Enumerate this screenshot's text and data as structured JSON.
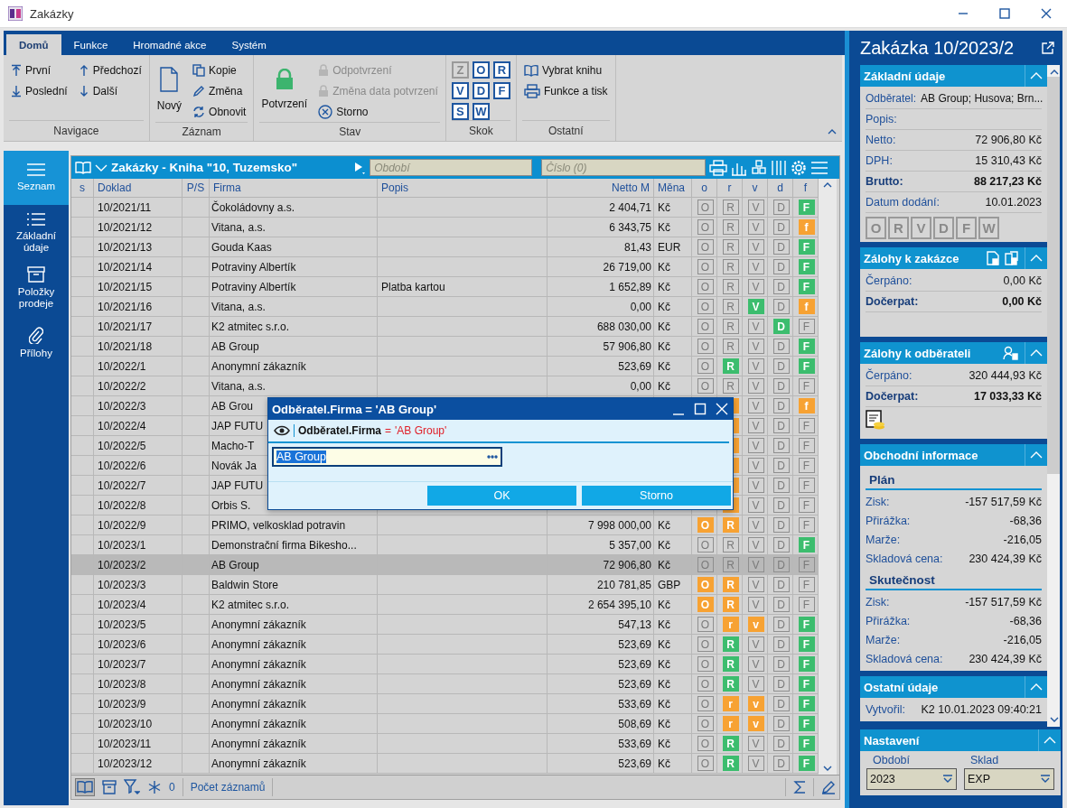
{
  "window": {
    "title": "Zakázky"
  },
  "ribbon": {
    "tabs": [
      {
        "label": "Domů",
        "selected": true
      },
      {
        "label": "Funkce",
        "selected": false
      },
      {
        "label": "Hromadné akce",
        "selected": false
      },
      {
        "label": "Systém",
        "selected": false
      }
    ],
    "groups": [
      {
        "kind": "nav",
        "title": "Navigace",
        "items": [
          {
            "label": "První"
          },
          {
            "label": "Předchozí"
          },
          {
            "label": "Poslední"
          },
          {
            "label": "Další"
          }
        ]
      },
      {
        "kind": "record",
        "title": "Záznam",
        "items": [
          {
            "label": "Nový"
          },
          {
            "label": "Kopie"
          },
          {
            "label": "Změna"
          },
          {
            "label": "Obnovit"
          }
        ]
      },
      {
        "kind": "state",
        "title": "Stav",
        "items": [
          {
            "label": "Potvrzení",
            "disabled": false
          },
          {
            "label": "Odpotvrzení",
            "disabled": true
          },
          {
            "label": "Změna data potvrzení",
            "disabled": true
          },
          {
            "label": "Storno",
            "disabled": false
          }
        ]
      },
      {
        "kind": "jump",
        "title": "Skok",
        "items": [
          {
            "label": "Z",
            "disabled": true
          },
          {
            "label": "O",
            "disabled": false
          },
          {
            "label": "R",
            "disabled": false
          },
          {
            "label": "V",
            "disabled": false
          },
          {
            "label": "D",
            "disabled": false
          },
          {
            "label": "F",
            "disabled": false
          },
          {
            "label": "S",
            "disabled": false
          },
          {
            "label": "W",
            "disabled": false
          }
        ]
      },
      {
        "kind": "other",
        "title": "Ostatní",
        "items": [
          {
            "label": "Vybrat knihu"
          },
          {
            "label": "Funkce a tisk"
          }
        ]
      }
    ]
  },
  "sidebar": {
    "items": [
      {
        "label": "Seznam",
        "selected": true
      },
      {
        "label": "Základní údaje",
        "selected": false
      },
      {
        "label": "Položky prodeje",
        "selected": false
      },
      {
        "label": "Přílohy",
        "selected": false
      }
    ]
  },
  "table": {
    "title": "Zakázky - Kniha \"10, Tuzemsko\"",
    "period_field": {
      "placeholder": "Období"
    },
    "number_field": {
      "placeholder": "Číslo (0)"
    },
    "columns": [
      "s",
      "Doklad",
      "P/S",
      "Firma",
      "Popis",
      "Netto M",
      "Měna",
      "o",
      "r",
      "v",
      "d",
      "f"
    ],
    "rows": [
      {
        "selected": false,
        "doklad": "10/2021/11",
        "firma": "Čokoládovny a.s.",
        "netto": "2 404,71",
        "mena": "Kč",
        "o": {
          "letter": "O",
          "active": false
        },
        "r": {
          "letter": "R",
          "active": false
        },
        "v": {
          "letter": "V",
          "active": false
        },
        "d": {
          "letter": "D",
          "active": false
        },
        "f": {
          "letter": "F",
          "active": true,
          "color": "#3cbd6e"
        }
      },
      {
        "selected": false,
        "doklad": "10/2021/12",
        "firma": "Vitana, a.s.",
        "netto": "6 343,75",
        "mena": "Kč",
        "o": {
          "letter": "O",
          "active": false
        },
        "r": {
          "letter": "R",
          "active": false
        },
        "v": {
          "letter": "V",
          "active": false
        },
        "d": {
          "letter": "D",
          "active": false
        },
        "f": {
          "letter": "f",
          "active": true,
          "color": "#f7a233"
        }
      },
      {
        "selected": false,
        "doklad": "10/2021/13",
        "firma": "Gouda Kaas",
        "netto": "81,43",
        "mena": "EUR",
        "o": {
          "letter": "O",
          "active": false
        },
        "r": {
          "letter": "R",
          "active": false
        },
        "v": {
          "letter": "V",
          "active": false
        },
        "d": {
          "letter": "D",
          "active": false
        },
        "f": {
          "letter": "F",
          "active": true,
          "color": "#3cbd6e"
        }
      },
      {
        "selected": false,
        "doklad": "10/2021/14",
        "firma": "Potraviny Albertík",
        "netto": "26 719,00",
        "mena": "Kč",
        "o": {
          "letter": "O",
          "active": false
        },
        "r": {
          "letter": "R",
          "active": false
        },
        "v": {
          "letter": "V",
          "active": false
        },
        "d": {
          "letter": "D",
          "active": false
        },
        "f": {
          "letter": "F",
          "active": true,
          "color": "#3cbd6e"
        }
      },
      {
        "selected": false,
        "doklad": "10/2021/15",
        "firma": "Potraviny Albertík",
        "popis": "Platba kartou",
        "netto": "1 652,89",
        "mena": "Kč",
        "o": {
          "letter": "O",
          "active": false
        },
        "r": {
          "letter": "R",
          "active": false
        },
        "v": {
          "letter": "V",
          "active": false
        },
        "d": {
          "letter": "D",
          "active": false
        },
        "f": {
          "letter": "F",
          "active": true,
          "color": "#3cbd6e"
        }
      },
      {
        "selected": false,
        "doklad": "10/2021/16",
        "firma": "Vitana, a.s.",
        "netto": "0,00",
        "mena": "Kč",
        "o": {
          "letter": "O",
          "active": false
        },
        "r": {
          "letter": "R",
          "active": false
        },
        "v": {
          "letter": "V",
          "active": true,
          "color": "#3cbd6e"
        },
        "d": {
          "letter": "D",
          "active": false
        },
        "f": {
          "letter": "f",
          "active": true,
          "color": "#f7a233"
        }
      },
      {
        "selected": false,
        "doklad": "10/2021/17",
        "firma": "K2 atmitec s.r.o.",
        "netto": "688 030,00",
        "mena": "Kč",
        "o": {
          "letter": "O",
          "active": false
        },
        "r": {
          "letter": "R",
          "active": false
        },
        "v": {
          "letter": "V",
          "active": false
        },
        "d": {
          "letter": "D",
          "active": true,
          "color": "#3cbd6e"
        },
        "f": {
          "letter": "F",
          "active": false
        }
      },
      {
        "selected": false,
        "doklad": "10/2021/18",
        "firma": "AB Group",
        "netto": "57 906,80",
        "mena": "Kč",
        "o": {
          "letter": "O",
          "active": false
        },
        "r": {
          "letter": "R",
          "active": false
        },
        "v": {
          "letter": "V",
          "active": false
        },
        "d": {
          "letter": "D",
          "active": false
        },
        "f": {
          "letter": "F",
          "active": true,
          "color": "#3cbd6e"
        }
      },
      {
        "selected": false,
        "doklad": "10/2022/1",
        "firma": "Anonymní zákazník",
        "netto": "523,69",
        "mena": "Kč",
        "o": {
          "letter": "O",
          "active": false
        },
        "r": {
          "letter": "R",
          "active": true,
          "color": "#3cbd6e"
        },
        "v": {
          "letter": "V",
          "active": false
        },
        "d": {
          "letter": "D",
          "active": false
        },
        "f": {
          "letter": "F",
          "active": true,
          "color": "#3cbd6e"
        }
      },
      {
        "selected": false,
        "doklad": "10/2022/2",
        "firma": "Vitana, a.s.",
        "netto": "0,00",
        "mena": "Kč",
        "o": {
          "letter": "O",
          "active": false
        },
        "r": {
          "letter": "R",
          "active": false
        },
        "v": {
          "letter": "V",
          "active": false
        },
        "d": {
          "letter": "D",
          "active": false
        },
        "f": {
          "letter": "F",
          "active": false
        }
      },
      {
        "selected": false,
        "doklad": "10/2022/3",
        "firma": "AB Grou",
        "r": {
          "active": true,
          "color": "#f7a233"
        },
        "v": {
          "letter": "V",
          "active": false
        },
        "d": {
          "letter": "D",
          "active": false
        },
        "f": {
          "letter": "f",
          "active": true,
          "color": "#f7a233"
        }
      },
      {
        "selected": false,
        "doklad": "10/2022/4",
        "firma": "JAP FUTU",
        "r": {
          "active": true,
          "color": "#f7a233"
        },
        "v": {
          "letter": "V",
          "active": false
        },
        "d": {
          "letter": "D",
          "active": false
        },
        "f": {
          "letter": "F",
          "active": false
        }
      },
      {
        "selected": false,
        "doklad": "10/2022/5",
        "firma": "Macho-T",
        "r": {
          "active": true,
          "color": "#f7a233"
        },
        "v": {
          "letter": "V",
          "active": false
        },
        "d": {
          "letter": "D",
          "active": false
        },
        "f": {
          "letter": "F",
          "active": false
        }
      },
      {
        "selected": false,
        "doklad": "10/2022/6",
        "firma": "Novák Ja",
        "r": {
          "active": true,
          "color": "#f7a233"
        },
        "v": {
          "letter": "V",
          "active": false
        },
        "d": {
          "letter": "D",
          "active": false
        },
        "f": {
          "letter": "F",
          "active": false
        }
      },
      {
        "selected": false,
        "doklad": "10/2022/7",
        "firma": "JAP FUTU",
        "r": {
          "active": true,
          "color": "#f7a233"
        },
        "v": {
          "letter": "V",
          "active": false
        },
        "d": {
          "letter": "D",
          "active": false
        },
        "f": {
          "letter": "F",
          "active": false
        }
      },
      {
        "selected": false,
        "doklad": "10/2022/8",
        "firma": "Orbis S.",
        "r": {
          "active": true,
          "color": "#f7a233"
        },
        "v": {
          "letter": "V",
          "active": false
        },
        "d": {
          "letter": "D",
          "active": false
        },
        "f": {
          "letter": "F",
          "active": false
        }
      },
      {
        "selected": false,
        "doklad": "10/2022/9",
        "firma": "PRIMO, velkosklad potravin",
        "netto": "7 998 000,00",
        "mena": "Kč",
        "o": {
          "letter": "O",
          "active": true,
          "color": "#f7a233"
        },
        "r": {
          "letter": "R",
          "active": true,
          "color": "#f7a233"
        },
        "v": {
          "letter": "V",
          "active": false
        },
        "d": {
          "letter": "D",
          "active": false
        },
        "f": {
          "letter": "F",
          "active": false
        }
      },
      {
        "selected": false,
        "doklad": "10/2023/1",
        "firma": "Demonstrační firma Bikesho...",
        "netto": "5 357,00",
        "mena": "Kč",
        "o": {
          "letter": "O",
          "active": false
        },
        "r": {
          "letter": "R",
          "active": false
        },
        "v": {
          "letter": "V",
          "active": false
        },
        "d": {
          "letter": "D",
          "active": false
        },
        "f": {
          "letter": "F",
          "active": true,
          "color": "#3cbd6e"
        }
      },
      {
        "selected": true,
        "doklad": "10/2023/2",
        "firma": "AB Group",
        "netto": "72 906,80",
        "mena": "Kč",
        "o": {
          "letter": "O",
          "active": false
        },
        "r": {
          "letter": "R",
          "active": false
        },
        "v": {
          "letter": "V",
          "active": false
        },
        "d": {
          "letter": "D",
          "active": false
        },
        "f": {
          "letter": "F",
          "active": false
        }
      },
      {
        "selected": false,
        "doklad": "10/2023/3",
        "firma": "Baldwin Store",
        "netto": "210 781,85",
        "mena": "GBP",
        "o": {
          "letter": "O",
          "active": true,
          "color": "#f7a233"
        },
        "r": {
          "letter": "R",
          "active": true,
          "color": "#f7a233"
        },
        "v": {
          "letter": "V",
          "active": false
        },
        "d": {
          "letter": "D",
          "active": false
        },
        "f": {
          "letter": "F",
          "active": false
        }
      },
      {
        "selected": false,
        "doklad": "10/2023/4",
        "firma": "K2 atmitec s.r.o.",
        "netto": "2 654 395,10",
        "mena": "Kč",
        "o": {
          "letter": "O",
          "active": true,
          "color": "#f7a233"
        },
        "r": {
          "letter": "R",
          "active": true,
          "color": "#f7a233"
        },
        "v": {
          "letter": "V",
          "active": false
        },
        "d": {
          "letter": "D",
          "active": false
        },
        "f": {
          "letter": "F",
          "active": false
        }
      },
      {
        "selected": false,
        "doklad": "10/2023/5",
        "firma": "Anonymní zákazník",
        "netto": "547,13",
        "mena": "Kč",
        "o": {
          "letter": "O",
          "active": false
        },
        "r": {
          "letter": "r",
          "active": true,
          "color": "#f7a233"
        },
        "v": {
          "letter": "v",
          "active": true,
          "color": "#f7a233"
        },
        "d": {
          "letter": "D",
          "active": false
        },
        "f": {
          "letter": "F",
          "active": true,
          "color": "#3cbd6e"
        }
      },
      {
        "selected": false,
        "doklad": "10/2023/6",
        "firma": "Anonymní zákazník",
        "netto": "523,69",
        "mena": "Kč",
        "o": {
          "letter": "O",
          "active": false
        },
        "r": {
          "letter": "R",
          "active": true,
          "color": "#3cbd6e"
        },
        "v": {
          "letter": "V",
          "active": false
        },
        "d": {
          "letter": "D",
          "active": false
        },
        "f": {
          "letter": "F",
          "active": true,
          "color": "#3cbd6e"
        }
      },
      {
        "selected": false,
        "doklad": "10/2023/7",
        "firma": "Anonymní zákazník",
        "netto": "523,69",
        "mena": "Kč",
        "o": {
          "letter": "O",
          "active": false
        },
        "r": {
          "letter": "R",
          "active": true,
          "color": "#3cbd6e"
        },
        "v": {
          "letter": "V",
          "active": false
        },
        "d": {
          "letter": "D",
          "active": false
        },
        "f": {
          "letter": "F",
          "active": true,
          "color": "#3cbd6e"
        }
      },
      {
        "selected": false,
        "doklad": "10/2023/8",
        "firma": "Anonymní zákazník",
        "netto": "523,69",
        "mena": "Kč",
        "o": {
          "letter": "O",
          "active": false
        },
        "r": {
          "letter": "R",
          "active": true,
          "color": "#3cbd6e"
        },
        "v": {
          "letter": "V",
          "active": false
        },
        "d": {
          "letter": "D",
          "active": false
        },
        "f": {
          "letter": "F",
          "active": true,
          "color": "#3cbd6e"
        }
      },
      {
        "selected": false,
        "doklad": "10/2023/9",
        "firma": "Anonymní zákazník",
        "netto": "533,69",
        "mena": "Kč",
        "o": {
          "letter": "O",
          "active": false
        },
        "r": {
          "letter": "r",
          "active": true,
          "color": "#f7a233"
        },
        "v": {
          "letter": "v",
          "active": true,
          "color": "#f7a233"
        },
        "d": {
          "letter": "D",
          "active": false
        },
        "f": {
          "letter": "F",
          "active": true,
          "color": "#3cbd6e"
        }
      },
      {
        "selected": false,
        "doklad": "10/2023/10",
        "firma": "Anonymní zákazník",
        "netto": "508,69",
        "mena": "Kč",
        "o": {
          "letter": "O",
          "active": false
        },
        "r": {
          "letter": "r",
          "active": true,
          "color": "#f7a233"
        },
        "v": {
          "letter": "v",
          "active": true,
          "color": "#f7a233"
        },
        "d": {
          "letter": "D",
          "active": false
        },
        "f": {
          "letter": "F",
          "active": true,
          "color": "#3cbd6e"
        }
      },
      {
        "selected": false,
        "doklad": "10/2023/11",
        "firma": "Anonymní zákazník",
        "netto": "533,69",
        "mena": "Kč",
        "o": {
          "letter": "O",
          "active": false
        },
        "r": {
          "letter": "R",
          "active": true,
          "color": "#3cbd6e"
        },
        "v": {
          "letter": "V",
          "active": false
        },
        "d": {
          "letter": "D",
          "active": false
        },
        "f": {
          "letter": "F",
          "active": true,
          "color": "#3cbd6e"
        }
      },
      {
        "selected": false,
        "doklad": "10/2023/12",
        "firma": "Anonymní zákazník",
        "netto": "523,69",
        "mena": "Kč",
        "o": {
          "letter": "O",
          "active": false
        },
        "r": {
          "letter": "R",
          "active": true,
          "color": "#3cbd6e"
        },
        "v": {
          "letter": "V",
          "active": false
        },
        "d": {
          "letter": "D",
          "active": false
        },
        "f": {
          "letter": "F",
          "active": true,
          "color": "#3cbd6e"
        }
      }
    ],
    "footer": {
      "count": "0",
      "label": "Počet záznamů"
    }
  },
  "dialog": {
    "title": "Odběratel.Firma = 'AB Group'",
    "condition": {
      "field": "Odběratel.Firma",
      "operator": "=",
      "value": "'AB Group'"
    },
    "input": {
      "value": "AB Group"
    },
    "buttons": [
      "OK",
      "Storno"
    ]
  },
  "detail": {
    "title": "Zakázka 10/2023/2",
    "sections": [
      {
        "kind": "basic",
        "title": "Základní údaje",
        "rows": [
          {
            "kind": "inline",
            "label": "Odběratel:",
            "value": "AB Group; Husova; Brn..."
          },
          {
            "kind": "field",
            "label": "Popis:"
          },
          {
            "kind": "field",
            "label": "Netto:",
            "value": "72 906,80 Kč"
          },
          {
            "kind": "field",
            "label": "DPH:",
            "value": "15 310,43 Kč"
          },
          {
            "kind": "total",
            "label": "Brutto:",
            "value": "88 217,23 Kč"
          },
          {
            "kind": "field",
            "label": "Datum dodání:",
            "value": "10.01.2023"
          }
        ],
        "flags": [
          {
            "letter": "O",
            "disabled": true
          },
          {
            "letter": "R",
            "disabled": true
          },
          {
            "letter": "V",
            "disabled": true
          },
          {
            "letter": "D",
            "disabled": true
          },
          {
            "letter": "F",
            "disabled": true
          },
          {
            "letter": "W",
            "disabled": true
          }
        ]
      },
      {
        "kind": "advances_order",
        "title": "Zálohy k zakázce",
        "rows": [
          {
            "kind": "field",
            "label": "Čerpáno:",
            "value": "0,00 Kč"
          },
          {
            "kind": "total",
            "label": "Dočerpat:",
            "value": "0,00 Kč"
          }
        ]
      },
      {
        "kind": "advances_customer",
        "title": "Zálohy k odběrateli",
        "rows": [
          {
            "kind": "field",
            "label": "Čerpáno:",
            "value": "320 444,93 Kč"
          },
          {
            "kind": "total",
            "label": "Dočerpat:",
            "value": "17 033,33 Kč"
          }
        ]
      },
      {
        "kind": "business",
        "title": "Obchodní informace",
        "rows": [
          {
            "kind": "heading",
            "label": "Plán"
          },
          {
            "kind": "plain",
            "label": "Zisk:",
            "value": "-157 517,59 Kč"
          },
          {
            "kind": "plain",
            "label": "Přirážka:",
            "value": "-68,36"
          },
          {
            "kind": "plain",
            "label": "Marže:",
            "value": "-216,05"
          },
          {
            "kind": "plain",
            "label": "Skladová cena:",
            "value": "230 424,39 Kč"
          },
          {
            "kind": "heading",
            "label": "Skutečnost"
          },
          {
            "kind": "plain",
            "label": "Zisk:",
            "value": "-157 517,59 Kč"
          },
          {
            "kind": "plain",
            "label": "Přirážka:",
            "value": "-68,36"
          },
          {
            "kind": "plain",
            "label": "Marže:",
            "value": "-216,05"
          },
          {
            "kind": "plain",
            "label": "Skladová cena:",
            "value": "230 424,39 Kč"
          }
        ]
      },
      {
        "kind": "other",
        "title": "Ostatní údaje",
        "rows": [
          {
            "kind": "plain",
            "label": "Vytvořil:",
            "value": "K2 10.01.2023 09:40:21"
          }
        ]
      }
    ],
    "settings": {
      "title": "Nastavení",
      "fields": [
        {
          "label": "Období",
          "value": "2023"
        },
        {
          "label": "Sklad",
          "value": "EXP"
        }
      ]
    }
  }
}
